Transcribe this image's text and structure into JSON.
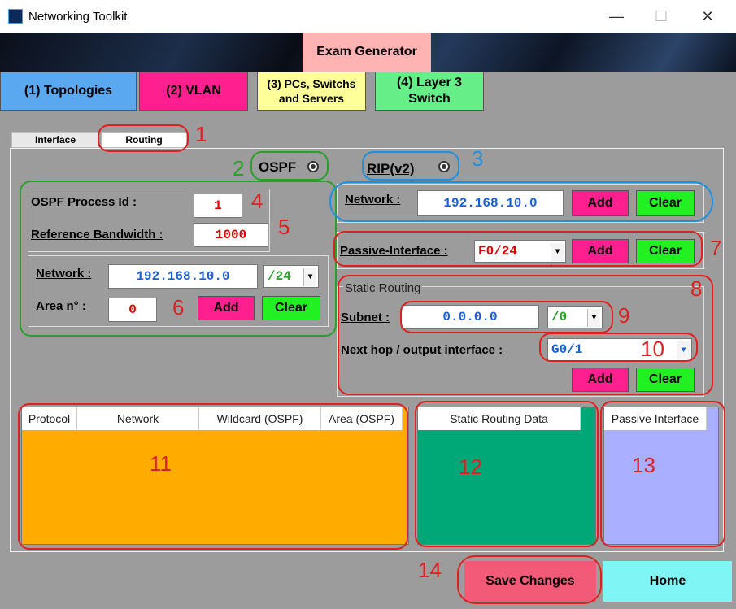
{
  "window": {
    "title": "Networking Toolkit",
    "minimize": "—",
    "maximize": "☐",
    "close": "✕"
  },
  "exam_button": "Exam Generator",
  "nav": {
    "topologies": "(1) Topologies",
    "vlan": "(2) VLAN",
    "pcs": "(3) PCs, Switchs and Servers",
    "layer3": "(4) Layer 3 Switch"
  },
  "tabs": {
    "interface": "Interface",
    "routing": "Routing"
  },
  "protocols": {
    "ospf": "OSPF",
    "rip": "RIP(v2)"
  },
  "ospf": {
    "process_label": "OSPF Process Id :",
    "process_value": "1",
    "bandwidth_label": "Reference Bandwidth :",
    "bandwidth_value": "1000",
    "network_label": "Network :",
    "network_value": "192.168.10.0",
    "mask_value": "/24",
    "area_label": "Area n° :",
    "area_value": "0",
    "add": "Add",
    "clear": "Clear"
  },
  "rip": {
    "network_label": "Network :",
    "network_value": "192.168.10.0",
    "add": "Add",
    "clear": "Clear"
  },
  "passive": {
    "label": "Passive-Interface :",
    "value": "F0/24",
    "add": "Add",
    "clear": "Clear"
  },
  "static": {
    "title": "Static Routing",
    "subnet_label": "Subnet :",
    "subnet_value": "0.0.0.0",
    "mask_value": "/0",
    "nexthop_label": "Next hop / output interface :",
    "nexthop_value": "G0/1",
    "add": "Add",
    "clear": "Clear"
  },
  "tables": {
    "routing": {
      "headers": [
        "Protocol",
        "Network",
        "Wildcard (OSPF)",
        "Area (OSPF)"
      ],
      "color": "#ffab00"
    },
    "static": {
      "header": "Static Routing Data",
      "color": "#00a878"
    },
    "passive": {
      "header": "Passive Interface",
      "color": "#aab0ff"
    }
  },
  "footer": {
    "save": "Save Changes",
    "home": "Home"
  },
  "annotations": [
    "1",
    "2",
    "3",
    "4",
    "5",
    "6",
    "7",
    "8",
    "9",
    "10",
    "11",
    "12",
    "13",
    "14"
  ],
  "colors": {
    "annotation_red": "#e02020",
    "annotation_green": "#2aa02a",
    "annotation_blue": "#1e90e0"
  }
}
